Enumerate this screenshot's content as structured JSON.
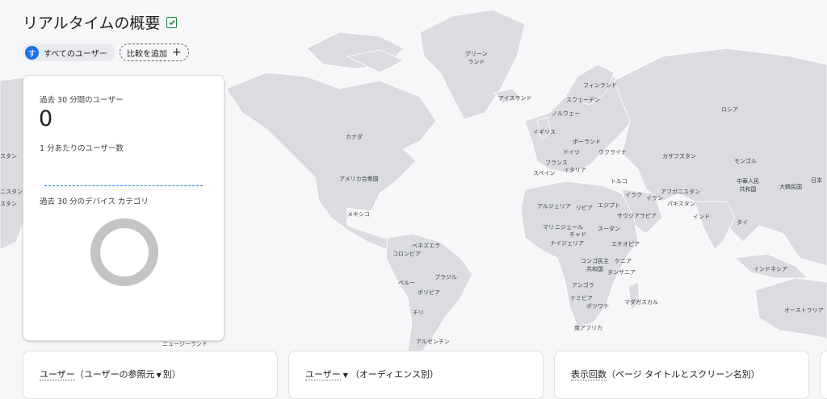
{
  "header": {
    "title": "リアルタイムの概要"
  },
  "segments": {
    "all_users": {
      "avatar_letter": "す",
      "label": "すべてのユーザー"
    },
    "add_comparison": {
      "label": "比較を追加",
      "icon": "+"
    }
  },
  "users_card": {
    "title": "過去 30 分間のユーザー",
    "value": "0",
    "per_minute_label": "1 分あたりのユーザー数",
    "device_label": "過去 30 分のデバイス カテゴリ"
  },
  "bottom_cards": [
    {
      "label": "ユーザー",
      "paren_before": "（ユーザーの参照元",
      "suffix": "別）"
    },
    {
      "label": "ユーザー",
      "paren": "（オーディエンス別）"
    },
    {
      "label": "表示回数",
      "paren": "（ページ タイトルとスクリーン名別）"
    }
  ],
  "map_labels": {
    "greenland": "グリーン\nランド",
    "iceland": "アイスランド",
    "finland": "フィンランド",
    "sweden": "スウェーデン",
    "norway": "ノルウェー",
    "russia": "ロシア",
    "canada": "カナダ",
    "uk": "イギリス",
    "poland": "ポーランド",
    "germany": "ドイツ",
    "ukraine": "ウクライナ",
    "kazakhstan": "カザフスタン",
    "france": "フランス",
    "mongolia": "モンゴル",
    "spain": "スペイン",
    "italy": "イタリア",
    "usa": "アメリカ合衆国",
    "turkey": "トルコ",
    "china": "中華人民\n共和国",
    "japan": "日本",
    "south_korea": "大韓民国",
    "afghanistan": "アフガニスタン",
    "iraq": "イラク",
    "iran": "イラン",
    "algeria": "アルジェリア",
    "libya": "リビア",
    "egypt": "エジプト",
    "pakistan": "パキスタン",
    "mexico": "メキシコ",
    "saudi": "サウジアラビア",
    "india": "インド",
    "thailand": "タイ",
    "mali": "マリ",
    "niger": "ニジェール",
    "sudan": "スーダン",
    "chad": "チャド",
    "venezuela": "ベネズエラ",
    "nigeria": "ナイジェリア",
    "ethiopia": "エチオピア",
    "colombia": "コロンビア",
    "drc": "コンゴ民主\n共和国",
    "kenya": "ケニア",
    "tanzania": "タンザニア",
    "indonesia": "インドネシア",
    "brazil": "ブラジル",
    "peru": "ペルー",
    "bolivia": "ボリビア",
    "angola": "アンゴラ",
    "namibia": "ナミビア",
    "madagascar": "マダガスカル",
    "botswana": "ボツワナ",
    "chile": "チリ",
    "australia": "オーストラリア",
    "south_africa": "南アフリカ",
    "argentina": "アルゼンチン",
    "new_zealand": "ニュージーランド",
    "stan_left": "スタン",
    "nistan_left": "ニスタン",
    "tan_left": "スタン"
  },
  "colors": {
    "accent": "#1a73e8",
    "land": "#dadce0",
    "sea": "#f6f7f8",
    "ring": "#c4c4c4"
  }
}
